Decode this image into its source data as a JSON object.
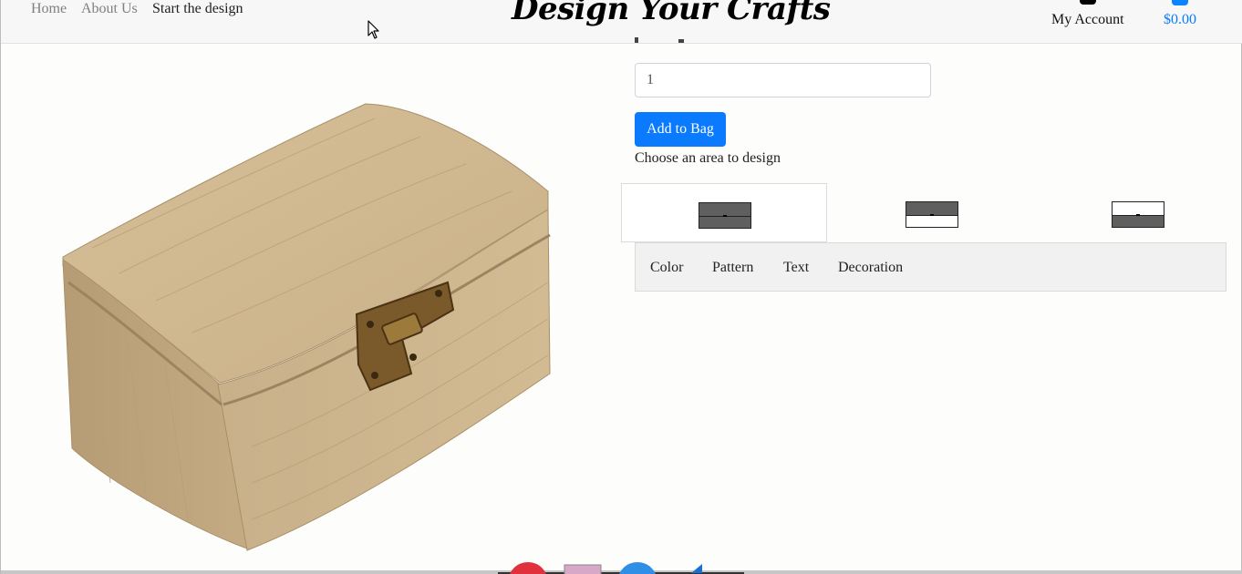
{
  "nav": {
    "links": [
      "Home",
      "About Us",
      "Start the design"
    ],
    "brand": "Design Your Crafts",
    "account_label": "My Account",
    "cart_total": "$0.00"
  },
  "product": {
    "quantity_value": "1",
    "add_to_bag_label": "Add to Bag",
    "choose_area_label": "Choose an area to design",
    "areas": [
      {
        "name": "bottom",
        "selected": true
      },
      {
        "name": "top",
        "selected": false
      },
      {
        "name": "bottom-alt",
        "selected": false
      }
    ]
  },
  "tool_tabs": [
    "Color",
    "Pattern",
    "Text",
    "Decoration"
  ],
  "colors": {
    "accent": "#0a7bff",
    "swatch_dark": "#5f5f5f",
    "wood_light": "#d8c39e",
    "wood_dark": "#b49a71"
  },
  "icons": {
    "account": "user-icon",
    "cart": "bag-icon",
    "cursor": "mouse-pointer-icon",
    "palette_red": "red-circle-swatch",
    "palette_pink": "pink-square-swatch",
    "palette_blue": "blue-circle-swatch",
    "palette_triangle": "blue-triangle-swatch"
  }
}
